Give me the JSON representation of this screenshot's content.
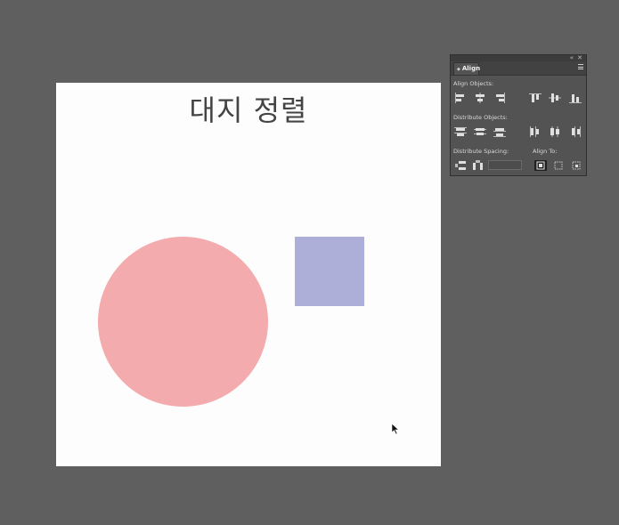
{
  "artboard": {
    "title": "대지 정렬"
  },
  "shapes": {
    "circle_color": "#f4abad",
    "square_color": "#aeafd8"
  },
  "align_panel": {
    "tab_label": "Align",
    "sections": {
      "align_objects": "Align Objects:",
      "distribute_objects": "Distribute Objects:",
      "distribute_spacing": "Distribute Spacing:",
      "align_to": "Align To:"
    },
    "align_objects_icons": [
      "horizontal-align-left-icon",
      "horizontal-align-center-icon",
      "horizontal-align-right-icon",
      "vertical-align-top-icon",
      "vertical-align-center-icon",
      "vertical-align-bottom-icon"
    ],
    "distribute_objects_icons": [
      "vertical-distribute-top-icon",
      "vertical-distribute-center-icon",
      "vertical-distribute-bottom-icon",
      "horizontal-distribute-left-icon",
      "horizontal-distribute-center-icon",
      "horizontal-distribute-right-icon"
    ],
    "distribute_spacing_icons": [
      "vertical-distribute-space-icon",
      "horizontal-distribute-space-icon"
    ],
    "align_to_icons": [
      "align-to-artboard-icon",
      "align-to-selection-icon",
      "align-to-key-object-icon"
    ],
    "align_to_active": "align-to-artboard-icon"
  }
}
